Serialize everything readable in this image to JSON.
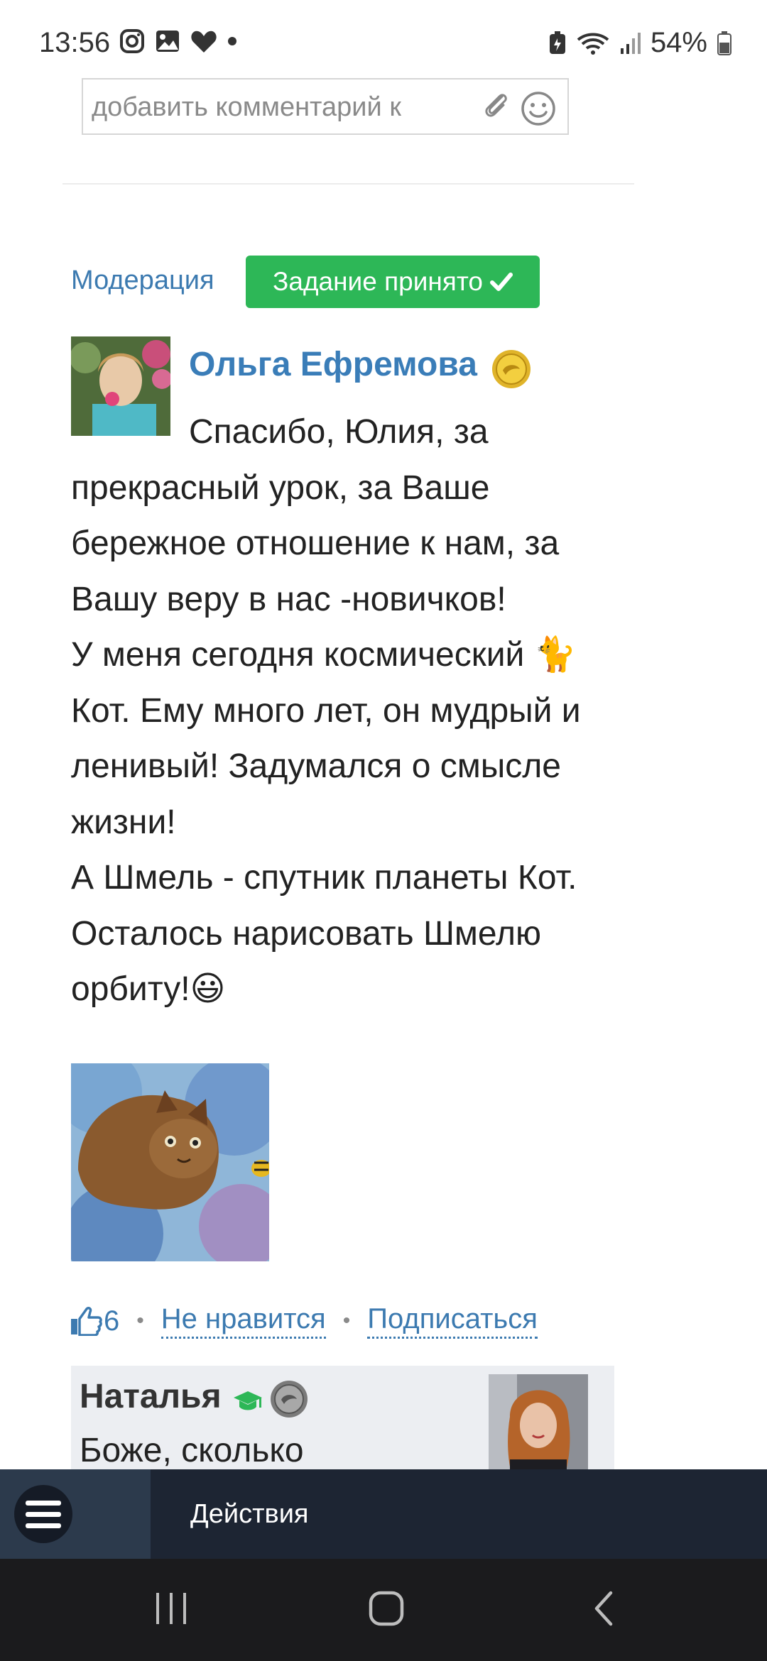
{
  "status_bar": {
    "time": "13:56",
    "battery": "54%",
    "icons_left": [
      "instagram-icon",
      "gallery-icon",
      "heart-icon",
      "dot-icon"
    ],
    "icons_right": [
      "battery-saver-icon",
      "wifi-icon",
      "signal-icon",
      "battery-icon"
    ]
  },
  "comment_box": {
    "placeholder": "добавить комментарий к"
  },
  "moderation": {
    "label": "Модерация",
    "status_badge": "Задание принято",
    "status_color": "#2db757"
  },
  "post": {
    "author": "Ольга Ефремова",
    "text_lines": [
      "Спасибо, Юлия, за",
      "прекрасный урок, за Ваше",
      "бережное отношение к нам, за",
      "Вашу веру в нас -новичков!",
      "У меня сегодня космический 🐈",
      "Кот. Ему много лет, он мудрый и",
      "ленивый! Задумался о смысле",
      "жизни!",
      "А Шмель - спутник планеты Кот.",
      "Осталось нарисовать Шмелю",
      "орбиту!😃"
    ]
  },
  "reactions": {
    "likes": "6",
    "dislike_label": "Не нравится",
    "subscribe_label": "Подписаться"
  },
  "reply": {
    "author": "Наталья",
    "text": "Боже, сколько"
  },
  "action_bar": {
    "label": "Действия"
  },
  "colors": {
    "link": "#3c7ab0",
    "author": "#3a7db8",
    "action_bar": "#1d2533"
  }
}
